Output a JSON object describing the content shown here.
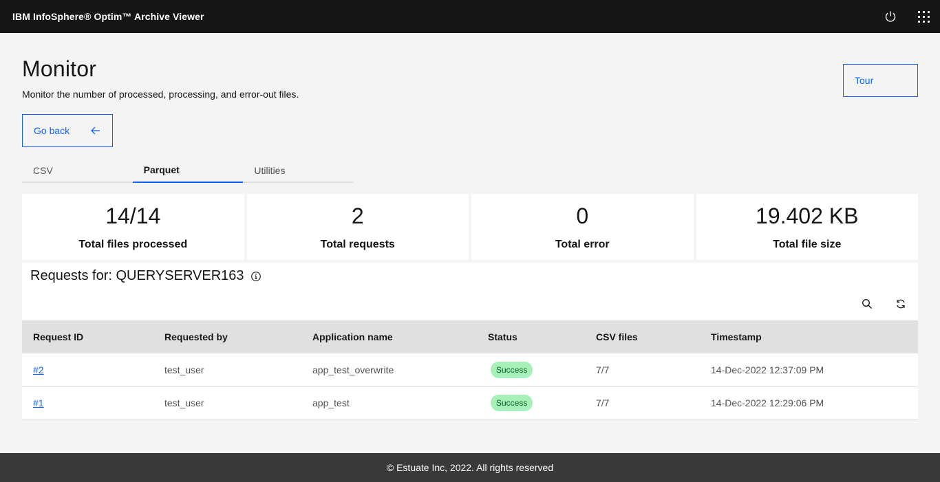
{
  "header": {
    "brand": "IBM InfoSphere® Optim™ Archive Viewer",
    "icons": [
      "power-icon",
      "app-switcher-icon"
    ]
  },
  "page": {
    "title": "Monitor",
    "description": "Monitor the number of processed, processing, and error-out files.",
    "tour_label": "Tour",
    "go_back_label": "Go back"
  },
  "tabs": [
    {
      "label": "CSV",
      "active": false
    },
    {
      "label": "Parquet",
      "active": true
    },
    {
      "label": "Utilities",
      "active": false
    }
  ],
  "stats": [
    {
      "value": "14/14",
      "label": "Total files processed"
    },
    {
      "value": "2",
      "label": "Total requests"
    },
    {
      "value": "0",
      "label": "Total error"
    },
    {
      "value": "19.402 KB",
      "label": "Total file size"
    }
  ],
  "requests": {
    "title": "Requests for: QUERYSERVER163",
    "columns": [
      "Request ID",
      "Requested by",
      "Application name",
      "Status",
      "CSV files",
      "Timestamp"
    ],
    "rows": [
      {
        "id": "#2",
        "requested_by": "test_user",
        "app_name": "app_test_overwrite",
        "status": "Success",
        "csv_files": "7/7",
        "timestamp": "14-Dec-2022 12:37:09 PM"
      },
      {
        "id": "#1",
        "requested_by": "test_user",
        "app_name": "app_test",
        "status": "Success",
        "csv_files": "7/7",
        "timestamp": "14-Dec-2022 12:29:06 PM"
      }
    ]
  },
  "footer": {
    "text": "© Estuate Inc, 2022.  All rights reserved"
  },
  "colors": {
    "accent": "#0f62fe",
    "header_bg": "#161616",
    "success_bg": "#a7f0ba",
    "footer_bg": "#393939"
  }
}
